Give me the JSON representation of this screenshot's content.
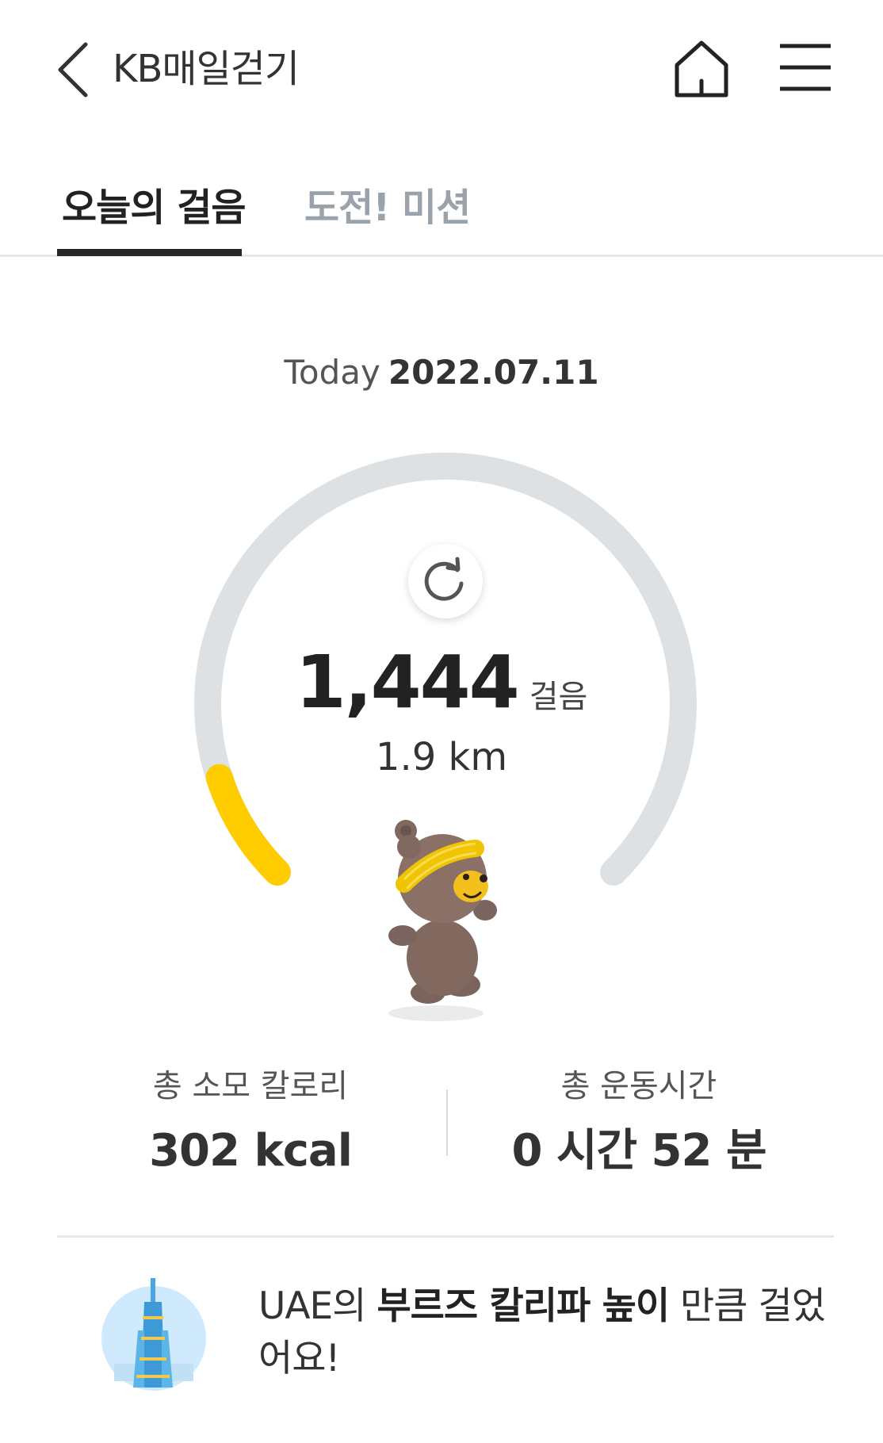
{
  "header": {
    "title": "KB매일걷기",
    "icons": {
      "back": "chevron-left-icon",
      "home": "home-icon",
      "menu": "hamburger-menu-icon"
    }
  },
  "tabs": [
    {
      "label": "오늘의 걸음",
      "active": true
    },
    {
      "label": "도전! 미션",
      "active": false
    }
  ],
  "today": {
    "label": "Today",
    "date": "2022.07.11"
  },
  "progress": {
    "steps": "1,444",
    "unit": "걸음",
    "distance": "1.9 km",
    "fraction": 0.1
  },
  "stats": {
    "calories": {
      "label": "총 소모 칼로리",
      "value": "302 kcal"
    },
    "exercise_time": {
      "label": "총 운동시간",
      "value": "0 시간 52 분"
    }
  },
  "landmark": {
    "prefix": "UAE의 ",
    "highlight": "부르즈 칼리파 높이",
    "suffix": " 만큼 걸었어요!"
  },
  "colors": {
    "accent": "#ffcc00",
    "track": "#dde1e4",
    "text": "#222222",
    "muted": "#9aa3ab"
  }
}
